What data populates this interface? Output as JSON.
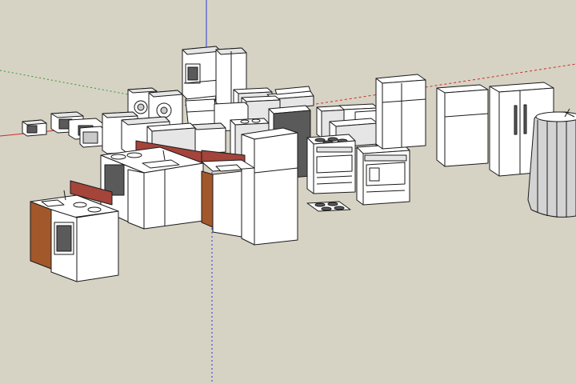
{
  "viewport": {
    "background": "#d7d3c4",
    "axes": {
      "red": "#cc2a2a",
      "green": "#2e9a3a",
      "blue": "#2a3ad0"
    }
  }
}
